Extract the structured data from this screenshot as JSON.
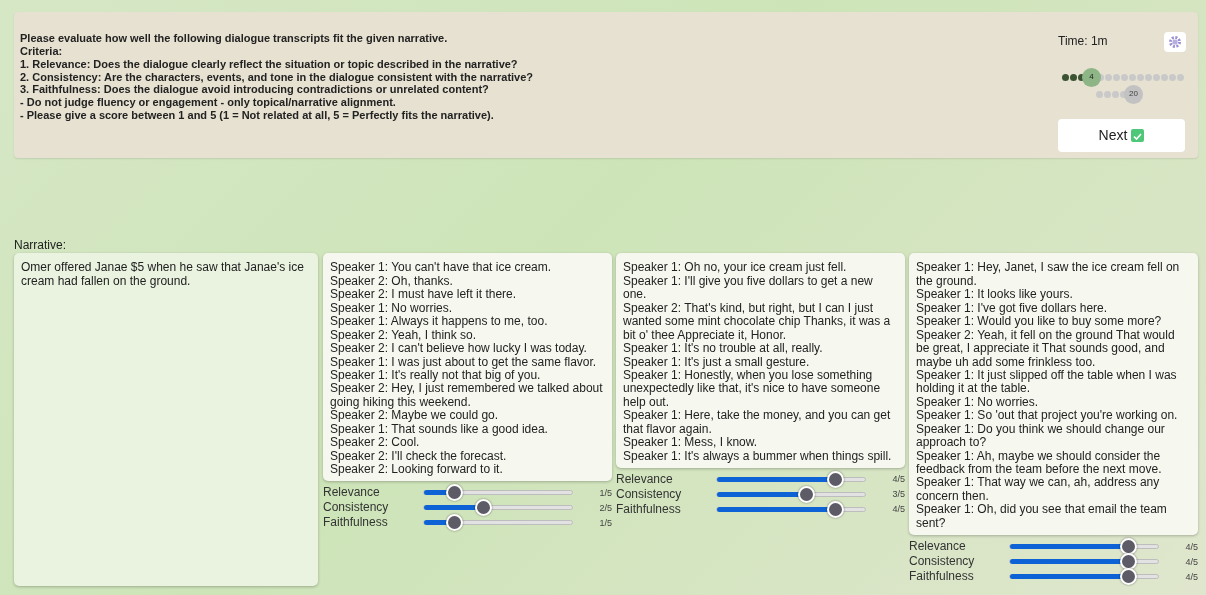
{
  "instructions": [
    "Please evaluate how well the following dialogue transcripts fit the given narrative.",
    "Criteria:",
    "1. Relevance: Does the dialogue clearly reflect the situation or topic described in the narrative?",
    "2. Consistency: Are the characters, events, and tone in the dialogue consistent with the narrative?",
    "3. Faithfulness: Does the dialogue avoid introducing contradictions or unrelated content?",
    "- Do not judge fluency or engagement - only topical/narrative alignment.",
    "- Please give a score between 1 and 5 (1 = Not related at all, 5 = Perfectly fits the narrative)."
  ],
  "timer": "Time: 1m",
  "progress": [
    {
      "done": true,
      "current": false
    },
    {
      "done": true,
      "current": false
    },
    {
      "done": true,
      "current": false
    },
    {
      "done": false,
      "current": true,
      "label": "4"
    },
    {
      "done": false,
      "current": false
    },
    {
      "done": false,
      "current": false
    },
    {
      "done": false,
      "current": false
    },
    {
      "done": false,
      "current": false
    },
    {
      "done": false,
      "current": false
    },
    {
      "done": false,
      "current": false
    },
    {
      "done": false,
      "current": false
    },
    {
      "done": false,
      "current": false
    },
    {
      "done": false,
      "current": false
    },
    {
      "done": false,
      "current": false
    },
    {
      "done": false,
      "current": false
    },
    {
      "done": false,
      "current": false
    },
    {
      "done": false,
      "current": false
    },
    {
      "done": false,
      "current": false
    },
    {
      "done": false,
      "current": false
    },
    {
      "done": false,
      "current": false,
      "label": "20"
    }
  ],
  "next_button": "Next",
  "narrative_label": "Narrative:",
  "narrative": "Omer offered Janae $5 when he saw that Janae's ice cream had fallen on the ground.",
  "dialogues": [
    {
      "lines": [
        "Speaker 1: You can't have that ice cream.",
        "Speaker 2: Oh, thanks.",
        "Speaker 2: I must have left it there.",
        "Speaker 1: No worries.",
        "Speaker 1: Always it happens to me, too.",
        "Speaker 2: Yeah, I think so.",
        "Speaker 2: I can't believe how lucky I was today.",
        "Speaker 1: I was just about to get the same flavor.",
        "Speaker 1: It's really not that big of you.",
        "Speaker 2: Hey, I just remembered we talked about going hiking this weekend.",
        "Speaker 2: Maybe we could go.",
        "Speaker 1: That sounds like a good idea.",
        "Speaker 2: Cool.",
        "Speaker 2: I'll check the forecast.",
        "Speaker 2: Looking forward to it."
      ],
      "ratings": [
        {
          "label": "Relevance",
          "level": 0.2,
          "reading": "1/5"
        },
        {
          "label": "Consistency",
          "level": 0.4,
          "reading": "2/5"
        },
        {
          "label": "Faithfulness",
          "level": 0.2,
          "reading": "1/5"
        }
      ]
    },
    {
      "lines": [
        "Speaker 1: Oh no, your ice cream just fell.",
        "Speaker 1: I'll give you five dollars to get a new one.",
        "Speaker 2: That's kind, but right, but I can I just wanted some mint chocolate chip Thanks, it was a bit o' thee Appreciate it, Honor.",
        "Speaker 1: It's no trouble at all, really.",
        "Speaker 1: It's just a small gesture.",
        "Speaker 1: Honestly, when you lose something unexpectedly like that, it's nice to have someone help out.",
        "Speaker 1: Here, take the money, and you can get that flavor again.",
        "Speaker 1: Mess, I know.",
        "Speaker 1: It's always a bummer when things spill."
      ],
      "ratings": [
        {
          "label": "Relevance",
          "level": 0.8,
          "reading": "4/5"
        },
        {
          "label": "Consistency",
          "level": 0.6,
          "reading": "3/5"
        },
        {
          "label": "Faithfulness",
          "level": 0.8,
          "reading": "4/5"
        }
      ]
    },
    {
      "lines": [
        "Speaker 1: Hey, Janet, I saw the ice cream fell on the ground.",
        "Speaker 1: It looks like yours.",
        "Speaker 1: I've got five dollars here.",
        "Speaker 1: Would you like to buy some more?",
        "Speaker 2: Yeah, it fell on the ground That would be great, I appreciate it That sounds good, and maybe uh add some frinkless too.",
        "Speaker 1: It just slipped off the table when I was holding it at the table.",
        "Speaker 1: No worries.",
        "Speaker 1: So 'out that project you're working on.",
        "Speaker 1: Do you think we should change our approach to?",
        "Speaker 1: Ah, maybe we should consider the feedback from the team before the next move.",
        "Speaker 1: That way we can, ah, address any concern then.",
        "Speaker 1: Oh, did you see that email the team sent?"
      ],
      "ratings": [
        {
          "label": "Relevance",
          "level": 0.8,
          "reading": "4/5"
        },
        {
          "label": "Consistency",
          "level": 0.8,
          "reading": "4/5"
        },
        {
          "label": "Faithfulness",
          "level": 0.8,
          "reading": "4/5"
        }
      ]
    }
  ]
}
